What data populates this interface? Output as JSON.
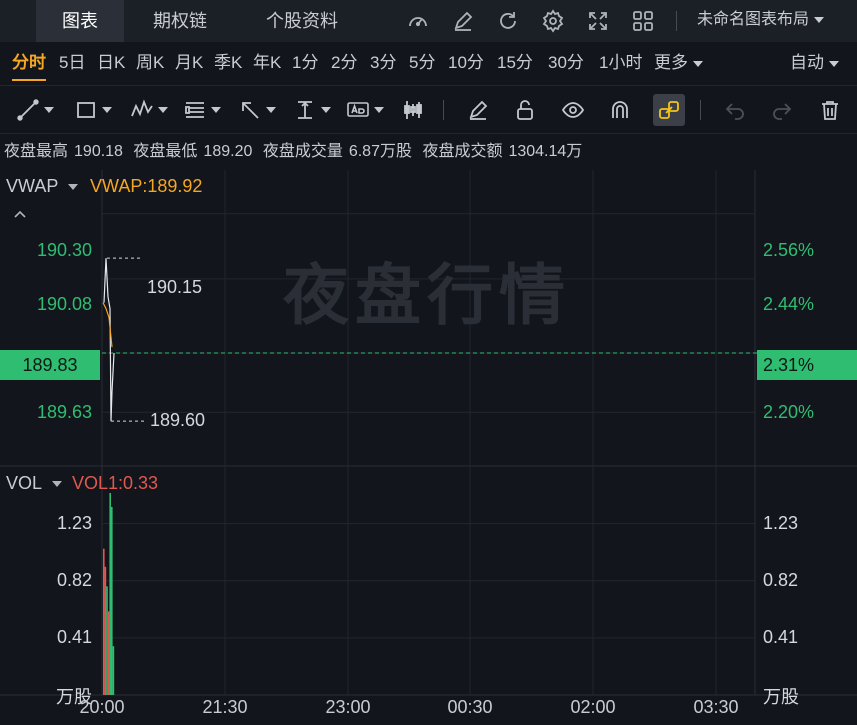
{
  "top_tabs": [
    "图表",
    "期权链",
    "个股资料"
  ],
  "layout_name": "未命名图表布局",
  "periods": [
    "分时",
    "5日",
    "日K",
    "周K",
    "月K",
    "季K",
    "年K",
    "1分",
    "2分",
    "3分",
    "5分",
    "10分",
    "15分",
    "30分",
    "1小时"
  ],
  "more_label": "更多",
  "auto_label": "自动",
  "info": {
    "high_label": "夜盘最高",
    "high": "190.18",
    "low_label": "夜盘最低",
    "low": "189.20",
    "vol_label": "夜盘成交量",
    "vol": "6.87万股",
    "amt_label": "夜盘成交额",
    "amt": "1304.14万"
  },
  "price_panel": {
    "indicator": "VWAP",
    "indicator_value": "VWAP:189.92",
    "y_left": [
      "190.30",
      "190.08",
      "189.83",
      "189.63"
    ],
    "y_right": [
      "2.56%",
      "2.44%",
      "2.31%",
      "2.20%"
    ],
    "high_marker": "190.15",
    "low_marker": "189.60",
    "watermark": "夜盘行情"
  },
  "volume_panel": {
    "indicator": "VOL",
    "indicator_value": "VOL1:0.33",
    "y_left": [
      "1.23",
      "0.82",
      "0.41",
      "万股"
    ],
    "y_right": [
      "1.23",
      "0.82",
      "0.41",
      "万股"
    ]
  },
  "x_labels": [
    "20:00",
    "21:30",
    "23:00",
    "00:30",
    "02:00",
    "03:30"
  ],
  "colors": {
    "accent": "#f5a623",
    "up": "#2fbd72",
    "down": "#e0584f",
    "vwap": "#f5a623"
  },
  "chart_data": {
    "type": "line",
    "title": "",
    "xlabel": "",
    "ylabel": "",
    "x": [
      "20:00",
      "21:30",
      "23:00",
      "00:30",
      "02:00",
      "03:30"
    ],
    "price": {
      "ylim": [
        189.55,
        190.38
      ],
      "series": [
        {
          "name": "VWAP",
          "values": [
            190.0,
            189.95,
            189.92
          ]
        }
      ],
      "high": 190.15,
      "low": 189.6,
      "last": 189.83,
      "change_pct_last": "2.31%"
    },
    "volume": {
      "unit": "万股",
      "ylim": [
        0,
        1.5
      ],
      "ticks": [
        0.41,
        0.82,
        1.23
      ],
      "bars": [
        1.05,
        0.92,
        0.78,
        0.6,
        1.45,
        1.35,
        0.35
      ]
    }
  }
}
